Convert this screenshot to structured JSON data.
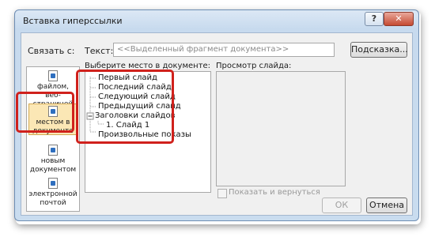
{
  "dialog": {
    "title": "Вставка гиперссылки",
    "help_label": "?",
    "close_label": "✕"
  },
  "link_to": {
    "label": "Связать с:",
    "items": [
      {
        "label": "файлом, веб-страницей",
        "icon": "web-page-icon"
      },
      {
        "label": "местом в документе",
        "icon": "place-in-document-icon",
        "selected": true
      },
      {
        "label": "новым документом",
        "icon": "new-document-icon"
      },
      {
        "label": "электронной почтой",
        "icon": "email-icon"
      }
    ]
  },
  "text_field": {
    "label": "Текст:",
    "value": "<<Выделенный фрагмент документа>>"
  },
  "hint_button": "Подсказка...",
  "place_label": "Выберите место в документе:",
  "tree": {
    "items": [
      {
        "label": "Первый слайд"
      },
      {
        "label": "Последний слайд"
      },
      {
        "label": "Следующий слайд"
      },
      {
        "label": "Предыдущий слайд"
      },
      {
        "label": "Заголовки слайдов"
      },
      {
        "label": "1. Слайд 1"
      },
      {
        "label": "Произвольные показы"
      }
    ]
  },
  "preview_label": "Просмотр слайда:",
  "show_and_return": "Показать и вернуться",
  "ok_label": "ОК",
  "cancel_label": "Отмена",
  "highlight_color": "#d0211c"
}
